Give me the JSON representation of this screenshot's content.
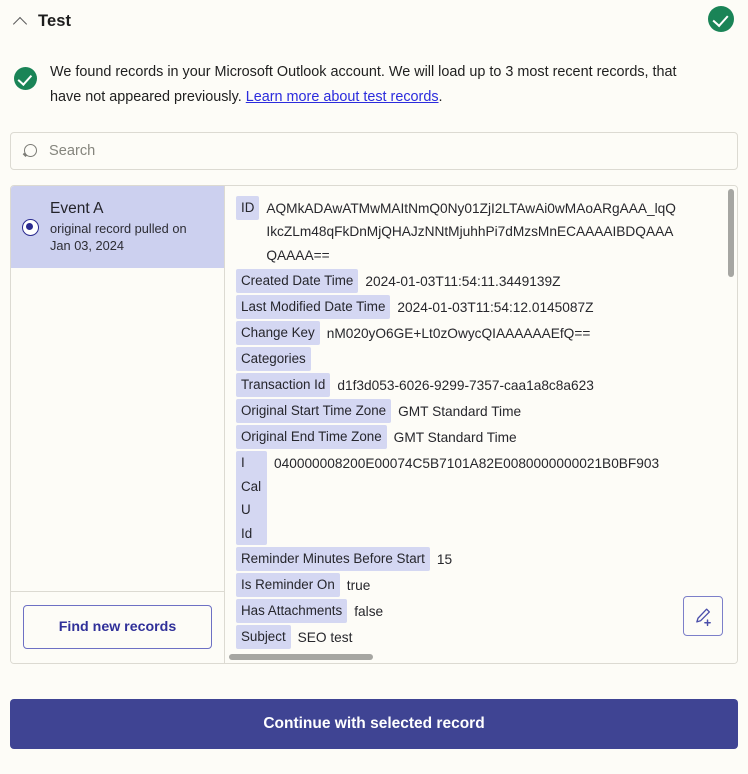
{
  "header": {
    "title": "Test",
    "collapse_icon": "chevron-up-icon",
    "status_icon": "check-circle-icon",
    "status_color": "#1a8457"
  },
  "notice": {
    "icon": "check-circle-icon",
    "text_before_link": "We found records in your Microsoft Outlook account. We will load up to 3 most recent records, that have not appeared previously. ",
    "link_text": "Learn more about test records",
    "text_after_link": "."
  },
  "search": {
    "icon": "search-icon",
    "placeholder": "Search",
    "value": ""
  },
  "record_list": {
    "items": [
      {
        "title": "Event A",
        "subtitle_line1": "original record pulled on",
        "subtitle_line2": "Jan 03, 2024",
        "selected": true
      }
    ],
    "find_button_label": "Find new records"
  },
  "record_detail": {
    "edit_icon": "pencil-plus-icon",
    "fields": [
      {
        "key": "ID",
        "value": "AQMkADAwATMwMAItNmQ0Ny01ZjI2LTAwAi0wMAoARgAAA_lqQ\nIkcZLm48qFkDnMjQHAJzNNtMjuhhPi7dMzsMnECAAAAIBDQAAA\nQAAAA==",
        "multiline": true
      },
      {
        "key": "Created Date Time",
        "value": "2024-01-03T11:54:11.3449139Z"
      },
      {
        "key": "Last Modified Date Time",
        "value": "2024-01-03T11:54:12.0145087Z"
      },
      {
        "key": "Change Key",
        "value": "nM020yO6GE+Lt0zOwycQIAAAAAAEfQ=="
      },
      {
        "key": "Categories",
        "value": ""
      },
      {
        "key": "Transaction Id",
        "value": "d1f3d053-6026-9299-7357-caa1a8c8a623"
      },
      {
        "key": "Original Start Time Zone",
        "value": "GMT Standard Time"
      },
      {
        "key": "Original End Time Zone",
        "value": "GMT Standard Time"
      },
      {
        "key": "I\nCal\nU\nId",
        "value": "040000008200E00074C5B7101A82E0080000000021B0BF903",
        "stacked": true
      },
      {
        "key": "Reminder Minutes Before Start",
        "value": "15"
      },
      {
        "key": "Is Reminder On",
        "value": "true"
      },
      {
        "key": "Has Attachments",
        "value": "false"
      },
      {
        "key": "Subject",
        "value": "SEO test"
      }
    ]
  },
  "footer": {
    "continue_label": "Continue with selected record"
  }
}
